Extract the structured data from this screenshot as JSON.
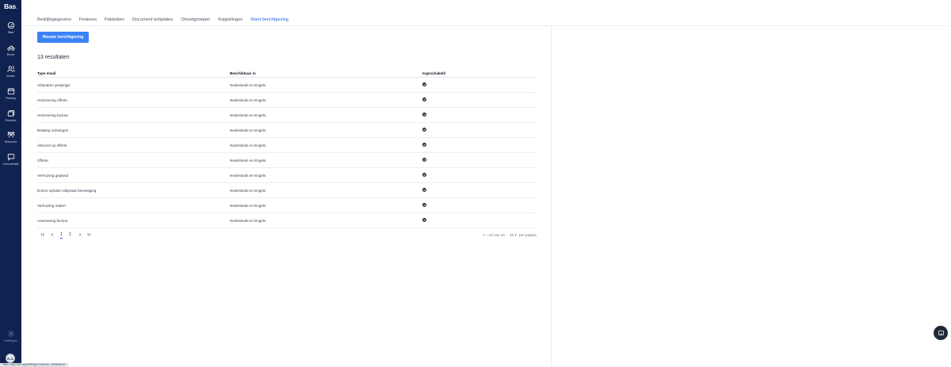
{
  "app": {
    "logo": "Bas",
    "logo_dot": "."
  },
  "sidebar": {
    "items": [
      {
        "label": "Start",
        "icon": "dashboard-icon"
      },
      {
        "label": "Moves",
        "icon": "bike-icon"
      },
      {
        "label": "Klanten",
        "icon": "users-icon"
      },
      {
        "label": "Planning",
        "icon": "calendar-icon"
      },
      {
        "label": "Financien",
        "icon": "wallet-icon"
      },
      {
        "label": "Resources",
        "icon": "team-icon"
      },
      {
        "label": "Communicatie",
        "icon": "message-icon"
      }
    ],
    "settings": {
      "label": "Instellingen",
      "icon": "gear-icon"
    },
    "avatar": "A.J."
  },
  "tabs": [
    {
      "label": "Bedrijfsgegevens",
      "active": false
    },
    {
      "label": "Features",
      "active": false
    },
    {
      "label": "Pakketten",
      "active": false
    },
    {
      "label": "Document templates",
      "active": false
    },
    {
      "label": "Omzetgroepen",
      "active": false
    },
    {
      "label": "Koppelingen",
      "active": false
    },
    {
      "label": "Klant berichtgeving",
      "active": true
    }
  ],
  "toolbar": {
    "new_label": "Nieuwe berichtgeving"
  },
  "results": {
    "label": "13 resultaten"
  },
  "table": {
    "headers": [
      "Type email",
      "Beschikbaar in",
      "Ingeschakeld"
    ],
    "rows": [
      {
        "type": "Afspraken gewijzigd",
        "available": "Nederlands en Engels",
        "enabled": true
      },
      {
        "type": "Herinnering offerte",
        "available": "Nederlands en Engels",
        "enabled": true
      },
      {
        "type": "Herinnering factuur",
        "available": "Nederlands en Engels",
        "enabled": true
      },
      {
        "type": "Betaling ontvangen",
        "available": "Nederlands en Engels",
        "enabled": true
      },
      {
        "type": "Akkoord op offerte",
        "available": "Nederlands en Engels",
        "enabled": true
      },
      {
        "type": "Offerte",
        "available": "Nederlands en Engels",
        "enabled": true
      },
      {
        "type": "Verhuizing gepland",
        "available": "Nederlands en Engels",
        "enabled": true
      },
      {
        "type": "Dozen ophalen afspraak bevestiging",
        "available": "Nederlands en Engels",
        "enabled": true
      },
      {
        "type": "Verhuizing nadert",
        "available": "Nederlands en Engels",
        "enabled": true
      },
      {
        "type": "Aanmaning factuur",
        "available": "Nederlands en Engels",
        "enabled": true
      }
    ]
  },
  "pagination": {
    "first": "first-page-icon",
    "prev": "chevron-left-icon",
    "pages": [
      "1",
      "2"
    ],
    "current_page": "1",
    "next": "chevron-right-icon",
    "last": "last-page-icon",
    "range": "1 – 10 van 13",
    "page_size": "10",
    "page_size_suffix": "per pagina"
  },
  "statusbar": {
    "url": "https://app.bas.app/settings/customer-notifications"
  },
  "colors": {
    "sidebar": "#10224f",
    "accent": "#3b82f6",
    "active_tab": "#2563eb"
  }
}
